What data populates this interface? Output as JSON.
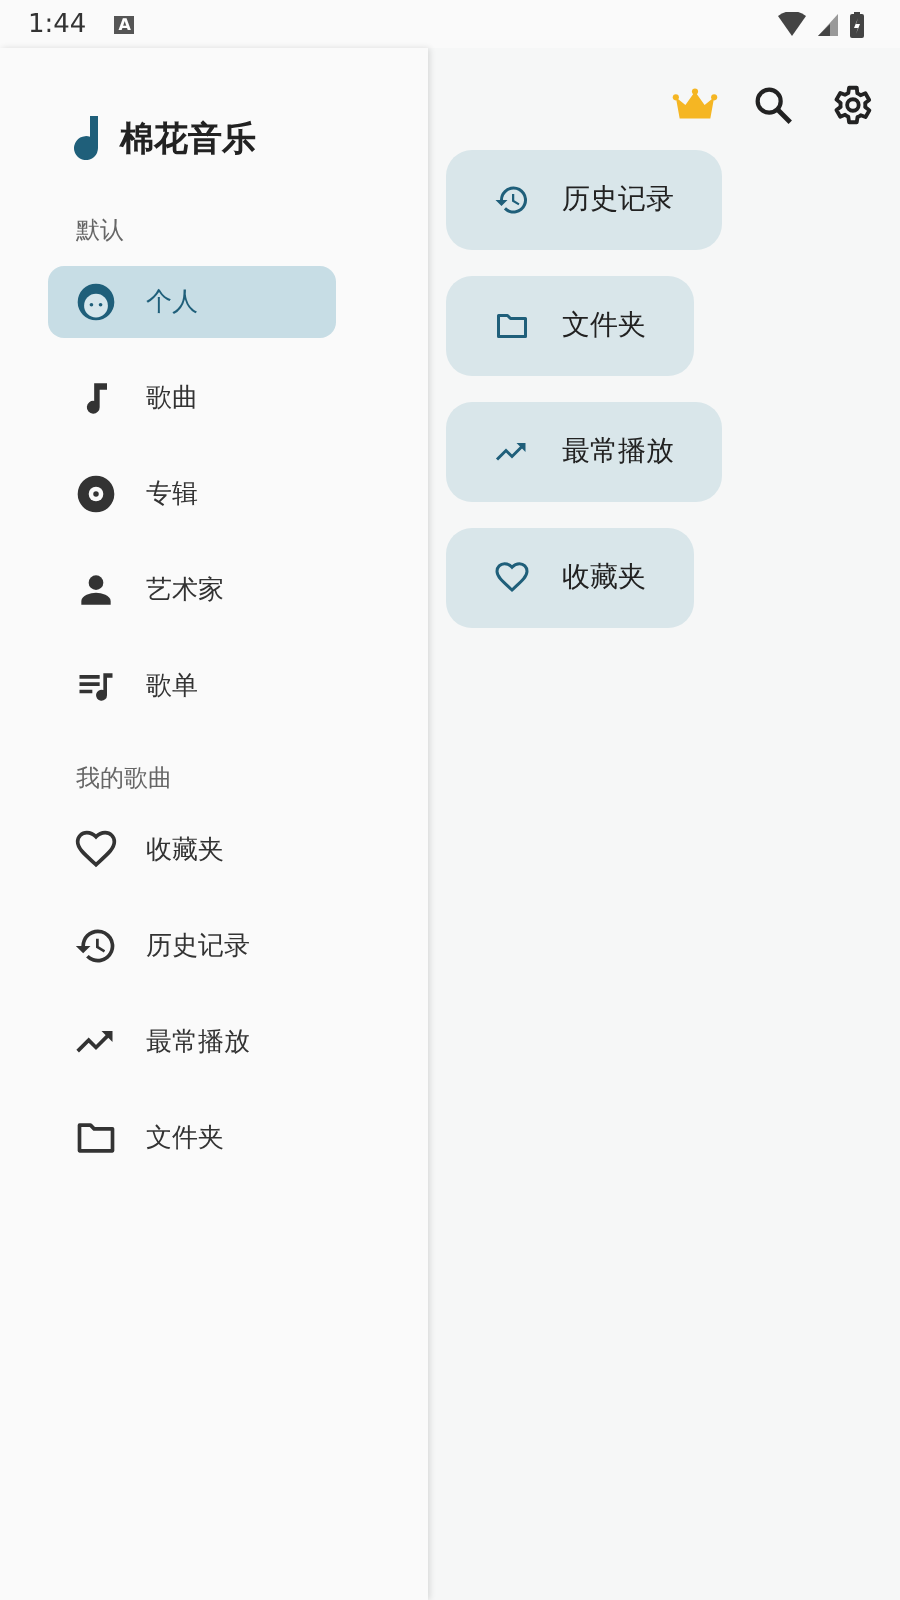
{
  "status_bar": {
    "time": "1:44",
    "notification": "A"
  },
  "drawer": {
    "title": "棉花音乐",
    "sections": [
      {
        "heading": "默认",
        "items": [
          {
            "label": "个人",
            "kind": "face",
            "selected": true
          },
          {
            "label": "歌曲",
            "kind": "note",
            "selected": false
          },
          {
            "label": "专辑",
            "kind": "disc",
            "selected": false
          },
          {
            "label": "艺术家",
            "kind": "person",
            "selected": false
          },
          {
            "label": "歌单",
            "kind": "playlist",
            "selected": false
          }
        ]
      },
      {
        "heading": "我的歌曲",
        "items": [
          {
            "label": "收藏夹",
            "kind": "heart",
            "selected": false
          },
          {
            "label": "历史记录",
            "kind": "history",
            "selected": false
          },
          {
            "label": "最常播放",
            "kind": "trending",
            "selected": false
          },
          {
            "label": "文件夹",
            "kind": "folder",
            "selected": false
          }
        ]
      }
    ]
  },
  "toolbar": {
    "actions": [
      {
        "kind": "crown"
      },
      {
        "kind": "search"
      },
      {
        "kind": "settings"
      }
    ]
  },
  "cards": [
    {
      "label": "历史记录",
      "kind": "history"
    },
    {
      "label": "文件夹",
      "kind": "folder"
    },
    {
      "label": "最常播放",
      "kind": "trending"
    },
    {
      "label": "收藏夹",
      "kind": "heart"
    }
  ]
}
